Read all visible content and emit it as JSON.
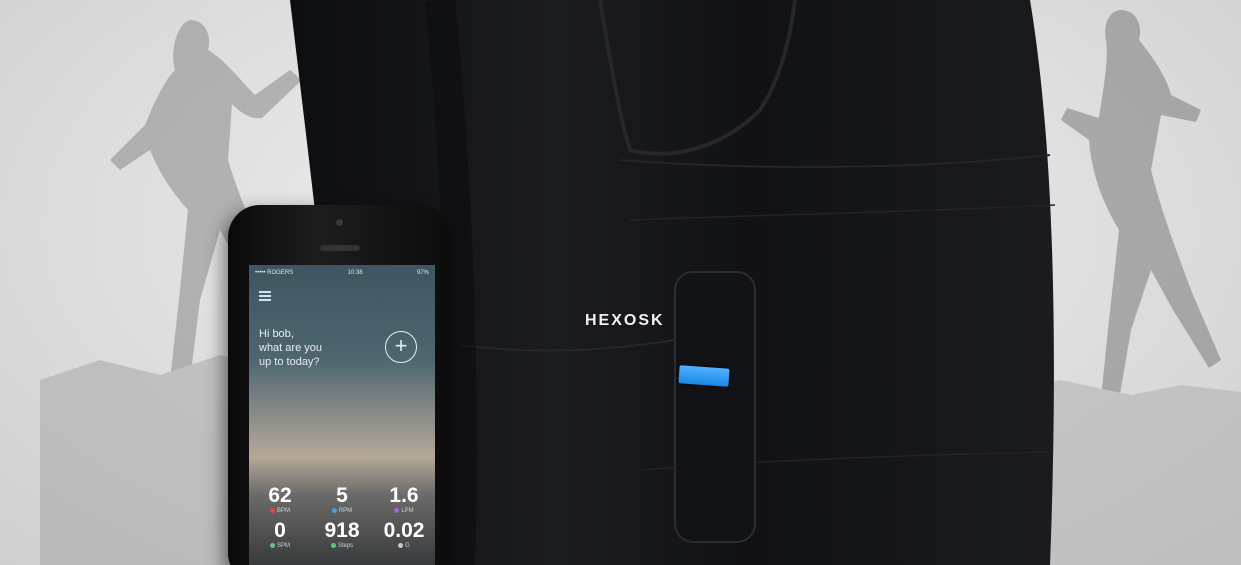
{
  "brand": {
    "label": "HEXOSK"
  },
  "phone": {
    "status": {
      "left": "••••• ROGERS",
      "time": "10:38",
      "right": "97%"
    },
    "greeting": {
      "line1": "Hi bob,",
      "line2": "what are you",
      "line3": "up to today?"
    },
    "add_label": "+",
    "metrics": [
      {
        "value": "62",
        "unit": "BPM",
        "color": "#e04848"
      },
      {
        "value": "5",
        "unit": "RPM",
        "color": "#4aa2e0"
      },
      {
        "value": "1.6",
        "unit": "LPM",
        "color": "#a06ad8"
      },
      {
        "value": "0",
        "unit": "SPM",
        "color": "#6fbf8a"
      },
      {
        "value": "918",
        "unit": "Steps",
        "color": "#5acb7a"
      },
      {
        "value": "0.02",
        "unit": "G",
        "color": "#c9c9c9"
      }
    ]
  },
  "colors": {
    "shirt": "#141518",
    "tag": "#2a93ee"
  }
}
